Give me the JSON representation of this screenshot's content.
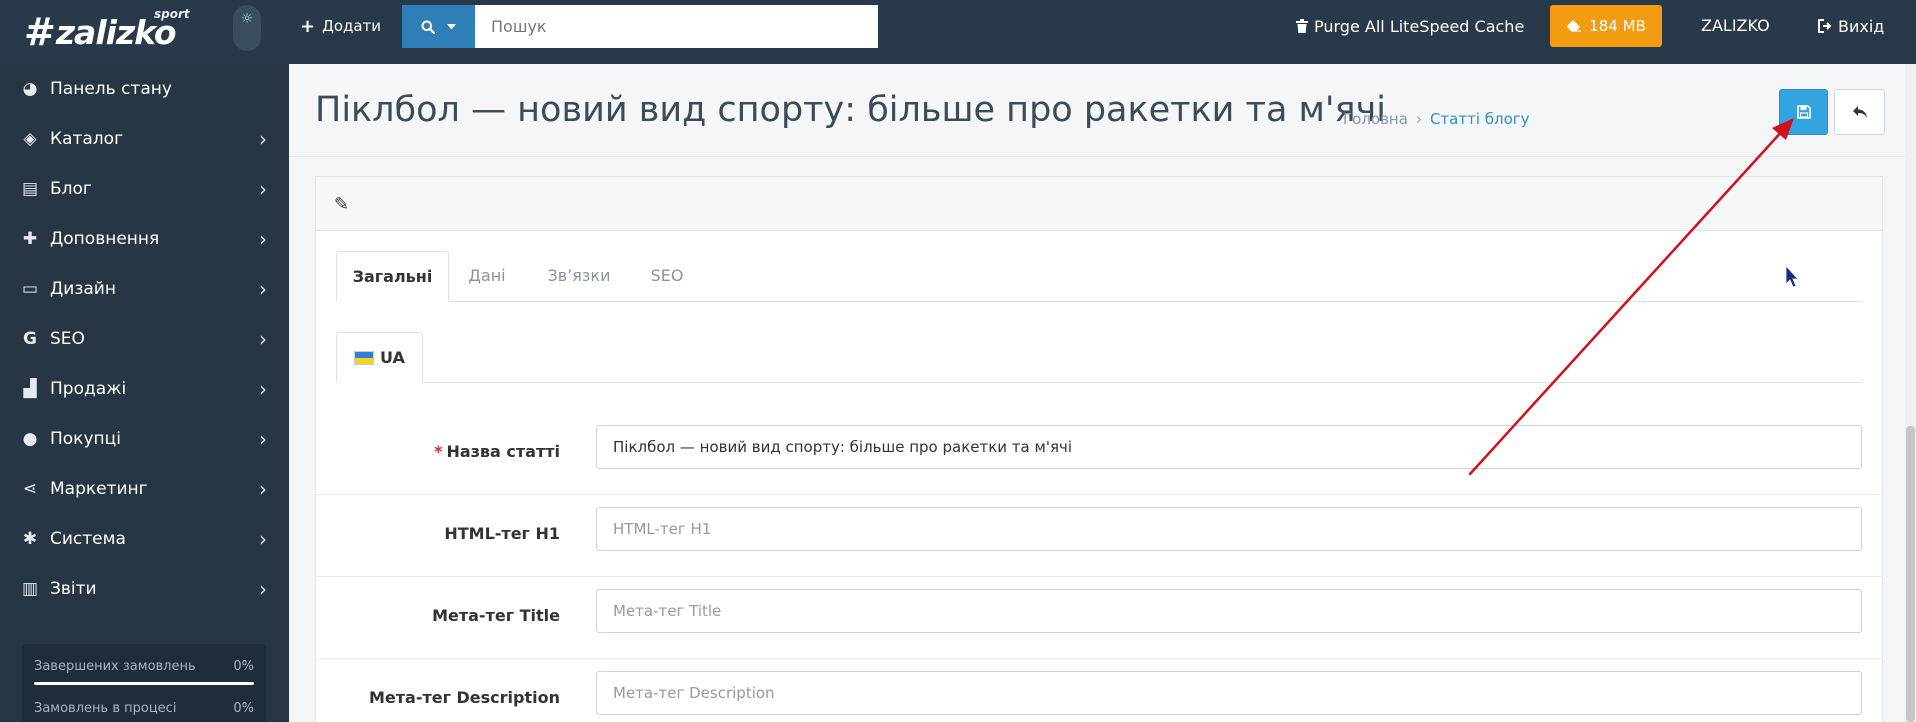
{
  "header": {
    "logo_text": "zalizko",
    "logo_hash": "#",
    "logo_sub": "sport",
    "add_label": "Додати",
    "search_placeholder": "Пошук",
    "purge_label": "Purge All LiteSpeed Cache",
    "memory_label": "184 MB",
    "user_label": "ZALIZKO",
    "logout_label": "Вихід",
    "colors": {
      "bg": "#283949",
      "search_btn": "#2f7eb8",
      "memory_btn": "#f39c12"
    }
  },
  "sidebar": {
    "items": [
      {
        "label": "Панель стану",
        "icon": "dashboard-icon",
        "has_arrow": false
      },
      {
        "label": "Каталог",
        "icon": "tags-icon",
        "has_arrow": true
      },
      {
        "label": "Блог",
        "icon": "book-icon",
        "has_arrow": true
      },
      {
        "label": "Доповнення",
        "icon": "puzzle-icon",
        "has_arrow": true
      },
      {
        "label": "Дизайн",
        "icon": "monitor-icon",
        "has_arrow": true
      },
      {
        "label": "SEO",
        "icon": "google-icon",
        "has_arrow": true
      },
      {
        "label": "Продажі",
        "icon": "cart-icon",
        "has_arrow": true
      },
      {
        "label": "Покупці",
        "icon": "user-icon",
        "has_arrow": true
      },
      {
        "label": "Маркетинг",
        "icon": "share-icon",
        "has_arrow": true
      },
      {
        "label": "Система",
        "icon": "cog-icon",
        "has_arrow": true
      },
      {
        "label": "Звіти",
        "icon": "bar-chart-icon",
        "has_arrow": true
      }
    ],
    "stats": [
      {
        "label": "Завершених замовлень",
        "value": "0%"
      },
      {
        "label": "Замовлень в процесі",
        "value": "0%"
      }
    ]
  },
  "page": {
    "title": "Піклбол — новий вид спорту: більше про ракетки та м'ячі",
    "breadcrumb": [
      {
        "label": "Головна"
      },
      {
        "label": "Статті блогу"
      }
    ],
    "breadcrumb_sep": "›",
    "save_color": "#33a4e0"
  },
  "panel": {
    "tabs": [
      {
        "label": "Загальні",
        "active": true
      },
      {
        "label": "Дані",
        "active": false
      },
      {
        "label": "Зв’язки",
        "active": false
      },
      {
        "label": "SEO",
        "active": false
      }
    ],
    "language_tab": "UA",
    "fields": [
      {
        "label": "Назва статті",
        "required": true,
        "value": "Піклбол — новий вид спорту: більше про ракетки та м'ячі",
        "placeholder": "Назва статті"
      },
      {
        "label": "HTML-тег H1",
        "required": false,
        "value": "",
        "placeholder": "HTML-тег H1"
      },
      {
        "label": "Мета-тег Title",
        "required": false,
        "value": "",
        "placeholder": "Мета-тег Title"
      },
      {
        "label": "Мета-тег Description",
        "required": false,
        "value": "",
        "placeholder": "Мета-тег Description"
      }
    ],
    "required_mark": "*"
  }
}
